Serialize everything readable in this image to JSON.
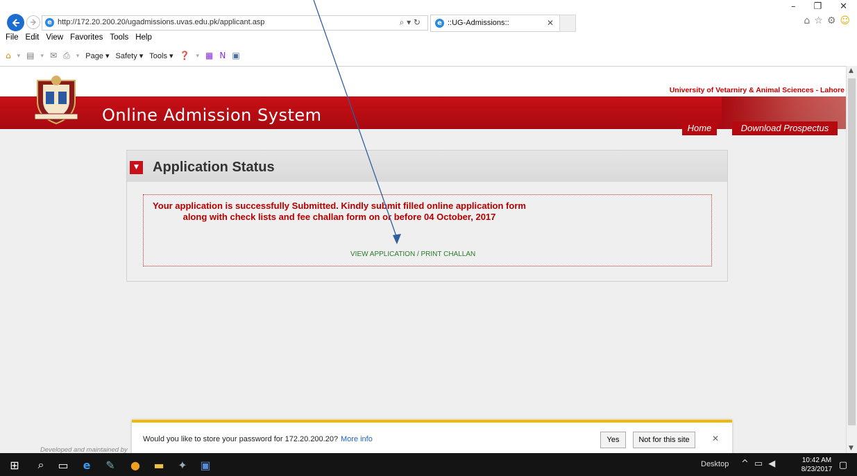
{
  "browser": {
    "url": "http://172.20.200.20/ugadmissions.uvas.edu.pk/applicant.asp",
    "url_host": "172.20.200.20",
    "tab_title": "::UG-Admissions::",
    "menu": [
      "File",
      "Edit",
      "View",
      "Favorites",
      "Tools",
      "Help"
    ],
    "command_bar": [
      "Page",
      "Safety",
      "Tools"
    ]
  },
  "site": {
    "university": "University of Vetarniry & Animal Sciences - Lahore",
    "title": "Online Admission System",
    "nav": {
      "home": "Home",
      "prospectus": "Download Prospectus"
    },
    "footer": "Developed and maintained by"
  },
  "panel": {
    "title": "Application Status",
    "message": "Your application is successfully Submitted.  Kindly submit filled online application form along with  check lists and fee challan form on or before 04 October, 2017",
    "link": "VIEW APPLICATION / PRINT CHALLAN"
  },
  "notification": {
    "message": "Would you like to store your password for 172.20.200.20?",
    "more_info": "More info",
    "yes": "Yes",
    "no": "Not for this site"
  },
  "taskbar": {
    "desktop": "Desktop",
    "time": "10:42 AM",
    "date": "8/23/2017"
  },
  "colors": {
    "brand_red": "#c80f16",
    "link_green": "#2a7a2a",
    "notification_accent": "#f2b800",
    "annotation_arrow": "#2f5f9e"
  }
}
